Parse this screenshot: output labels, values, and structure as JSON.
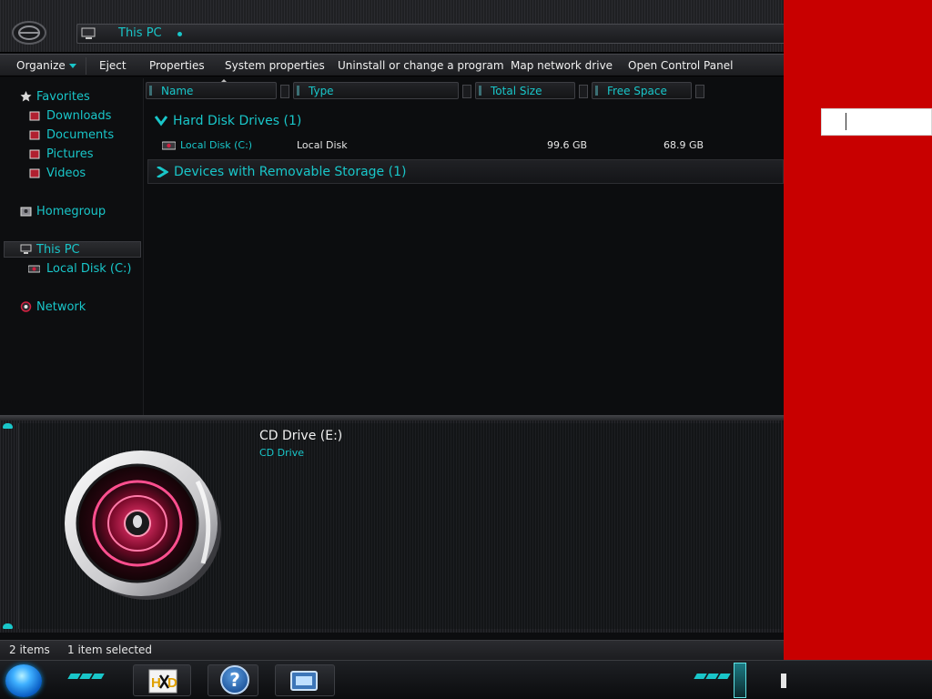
{
  "window": {
    "address": "This PC"
  },
  "commandbar": {
    "organize": "Organize",
    "eject": "Eject",
    "properties": "Properties",
    "system_properties": "System properties",
    "uninstall": "Uninstall or change a program",
    "map_network_drive": "Map network drive",
    "open_control_panel": "Open Control Panel"
  },
  "navpane": {
    "favorites": "Favorites",
    "downloads": "Downloads",
    "documents": "Documents",
    "pictures": "Pictures",
    "videos": "Videos",
    "homegroup": "Homegroup",
    "this_pc": "This PC",
    "local_disk": "Local Disk (C:)",
    "network": "Network"
  },
  "columns": {
    "name": "Name",
    "type": "Type",
    "total_size": "Total Size",
    "free_space": "Free Space"
  },
  "groups": {
    "hard_disk": "Hard Disk Drives (1)",
    "removable": "Devices with Removable Storage (1)"
  },
  "drives": [
    {
      "name": "Local Disk (C:)",
      "type": "Local Disk",
      "total": "99.6 GB",
      "free": "68.9 GB"
    }
  ],
  "details": {
    "title": "CD Drive (E:)",
    "subtitle": "CD Drive"
  },
  "status": {
    "count": "2 items",
    "selected": "1 item selected"
  },
  "taskbar": {
    "help_glyph": "?"
  },
  "colors": {
    "accent_teal": "#19c6c9",
    "desktop_red": "#c80000",
    "window_bg": "#0c0d0f"
  },
  "icons": [
    "nav-orb-icon",
    "computer-icon",
    "star-icon",
    "folder-icon",
    "homegroup-icon",
    "drive-icon",
    "network-icon",
    "chevron-down-icon",
    "chevron-right-icon",
    "cd-drive-icon",
    "start-orb-icon",
    "help-icon",
    "explorer-icon"
  ]
}
